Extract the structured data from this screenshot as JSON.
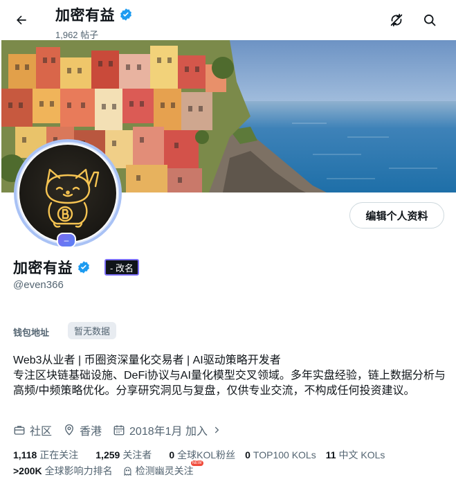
{
  "header": {
    "title": "加密有益",
    "posts_count": "1,962 帖子"
  },
  "avatar_badge": "–",
  "edit_profile_label": "编辑个人资料",
  "profile": {
    "name": "加密有益",
    "rename_label": "- 改名",
    "handle": "@even366"
  },
  "wallet": {
    "label": "钱包地址",
    "value": "暂无数据"
  },
  "bio": {
    "line1": "Web3从业者 | 币圈资深量化交易者 | AI驱动策略开发者",
    "line2": "专注区块链基础设施、DeFi协议与AI量化模型交叉领域。多年实盘经验，链上数据分析与高频/中频策略优化。分享研究洞见与复盘，仅供专业交流，不构成任何投资建议。"
  },
  "meta": {
    "community": "社区",
    "location": "香港",
    "joined": "2018年1月 加入"
  },
  "stats": {
    "following_count": "1,118",
    "following_label": "正在关注",
    "followers_count": "1,259",
    "followers_label": "关注者",
    "kol_followers_count": "0",
    "kol_followers_label": "全球KOL粉丝",
    "top100_count": "0",
    "top100_label": "TOP100 KOLs",
    "cn_kols_count": "11",
    "cn_kols_label": "中文 KOLs",
    "rank_value": ">200K",
    "rank_label": "全球影响力排名",
    "ghost_label": "检测幽灵关注",
    "new_tag": "NEW"
  },
  "colors": {
    "verified": "#1d9bf0",
    "accent": "#7b6ef5",
    "text_secondary": "#536471"
  },
  "icons": [
    "back-arrow-icon",
    "verified-badge-icon",
    "sync-off-icon",
    "search-icon",
    "briefcase-icon",
    "location-pin-icon",
    "calendar-icon",
    "chevron-right-icon",
    "ghost-icon"
  ]
}
